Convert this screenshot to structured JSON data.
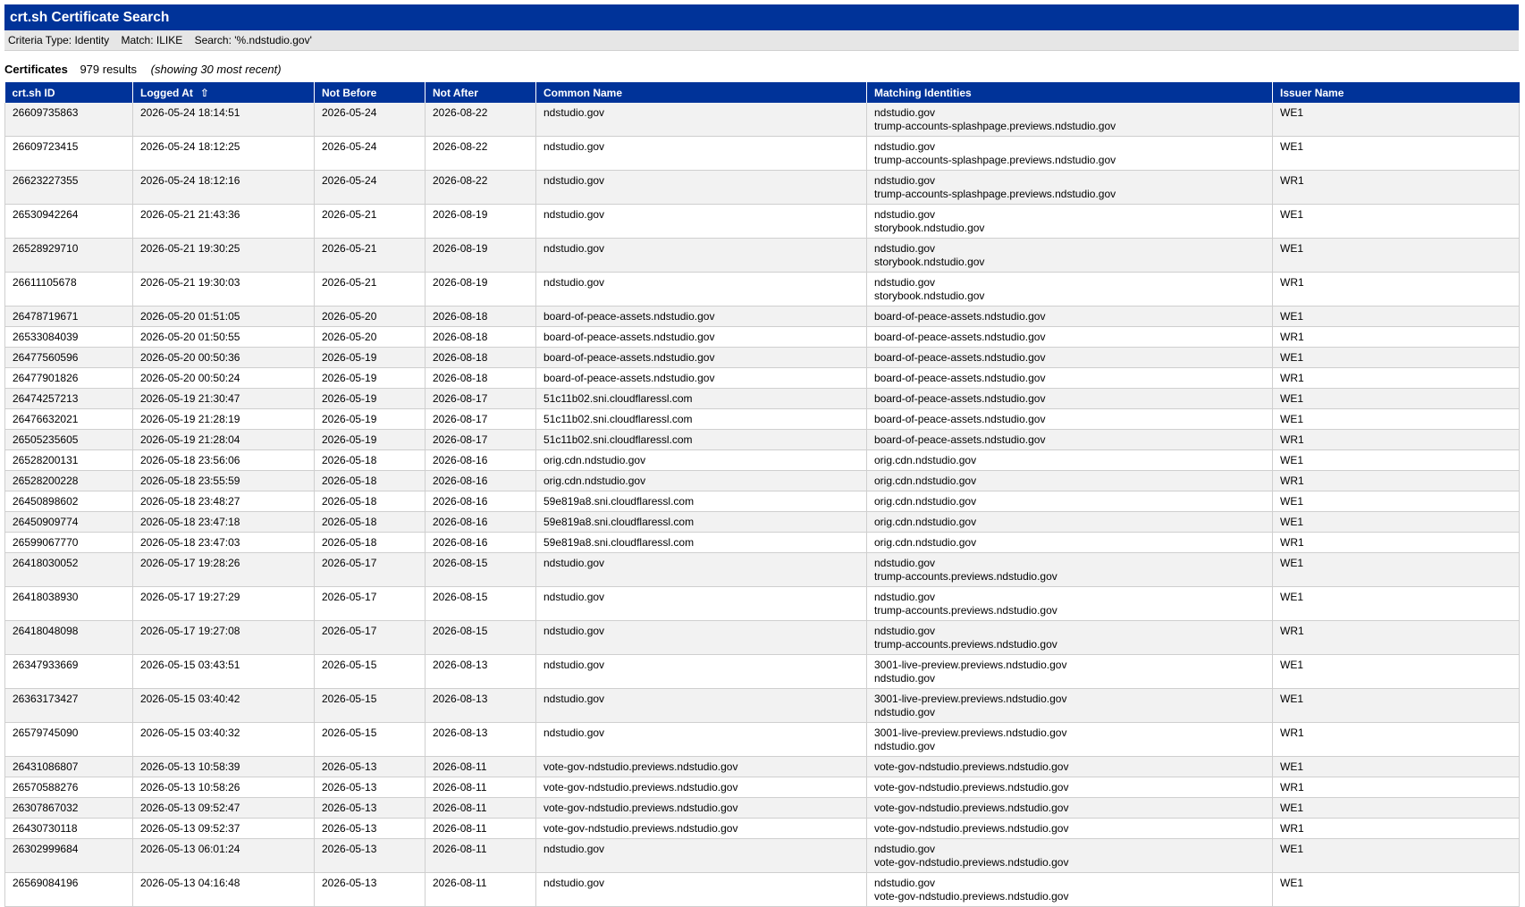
{
  "header": {
    "title": "crt.sh Certificate Search"
  },
  "criteria": {
    "type": "Criteria Type: Identity",
    "match": "Match: ILIKE",
    "search": "Search: '%.ndstudio.gov'"
  },
  "summary": {
    "label": "Certificates",
    "count": "979 results",
    "note": "(showing 30 most recent)"
  },
  "table": {
    "columns": [
      "crt.sh ID",
      "Logged At",
      "Not Before",
      "Not After",
      "Common Name",
      "Matching Identities",
      "Issuer Name"
    ],
    "sort_icon": "up-arrow-icon",
    "sort_glyph": "⇧",
    "rows": [
      {
        "id": "26609735863",
        "logged": "2026-05-24 18:14:51",
        "nb": "2026-05-24",
        "na": "2026-08-22",
        "cn": "ndstudio.gov",
        "ids": [
          "ndstudio.gov",
          "trump-accounts-splashpage.previews.ndstudio.gov"
        ],
        "issuer": "WE1"
      },
      {
        "id": "26609723415",
        "logged": "2026-05-24 18:12:25",
        "nb": "2026-05-24",
        "na": "2026-08-22",
        "cn": "ndstudio.gov",
        "ids": [
          "ndstudio.gov",
          "trump-accounts-splashpage.previews.ndstudio.gov"
        ],
        "issuer": "WE1"
      },
      {
        "id": "26623227355",
        "logged": "2026-05-24 18:12:16",
        "nb": "2026-05-24",
        "na": "2026-08-22",
        "cn": "ndstudio.gov",
        "ids": [
          "ndstudio.gov",
          "trump-accounts-splashpage.previews.ndstudio.gov"
        ],
        "issuer": "WR1"
      },
      {
        "id": "26530942264",
        "logged": "2026-05-21 21:43:36",
        "nb": "2026-05-21",
        "na": "2026-08-19",
        "cn": "ndstudio.gov",
        "ids": [
          "ndstudio.gov",
          "storybook.ndstudio.gov"
        ],
        "issuer": "WE1"
      },
      {
        "id": "26528929710",
        "logged": "2026-05-21 19:30:25",
        "nb": "2026-05-21",
        "na": "2026-08-19",
        "cn": "ndstudio.gov",
        "ids": [
          "ndstudio.gov",
          "storybook.ndstudio.gov"
        ],
        "issuer": "WE1"
      },
      {
        "id": "26611105678",
        "logged": "2026-05-21 19:30:03",
        "nb": "2026-05-21",
        "na": "2026-08-19",
        "cn": "ndstudio.gov",
        "ids": [
          "ndstudio.gov",
          "storybook.ndstudio.gov"
        ],
        "issuer": "WR1"
      },
      {
        "id": "26478719671",
        "logged": "2026-05-20 01:51:05",
        "nb": "2026-05-20",
        "na": "2026-08-18",
        "cn": "board-of-peace-assets.ndstudio.gov",
        "ids": [
          "board-of-peace-assets.ndstudio.gov"
        ],
        "issuer": "WE1"
      },
      {
        "id": "26533084039",
        "logged": "2026-05-20 01:50:55",
        "nb": "2026-05-20",
        "na": "2026-08-18",
        "cn": "board-of-peace-assets.ndstudio.gov",
        "ids": [
          "board-of-peace-assets.ndstudio.gov"
        ],
        "issuer": "WR1"
      },
      {
        "id": "26477560596",
        "logged": "2026-05-20 00:50:36",
        "nb": "2026-05-19",
        "na": "2026-08-18",
        "cn": "board-of-peace-assets.ndstudio.gov",
        "ids": [
          "board-of-peace-assets.ndstudio.gov"
        ],
        "issuer": "WE1"
      },
      {
        "id": "26477901826",
        "logged": "2026-05-20 00:50:24",
        "nb": "2026-05-19",
        "na": "2026-08-18",
        "cn": "board-of-peace-assets.ndstudio.gov",
        "ids": [
          "board-of-peace-assets.ndstudio.gov"
        ],
        "issuer": "WR1"
      },
      {
        "id": "26474257213",
        "logged": "2026-05-19 21:30:47",
        "nb": "2026-05-19",
        "na": "2026-08-17",
        "cn": "51c11b02.sni.cloudflaressl.com",
        "ids": [
          "board-of-peace-assets.ndstudio.gov"
        ],
        "issuer": "WE1"
      },
      {
        "id": "26476632021",
        "logged": "2026-05-19 21:28:19",
        "nb": "2026-05-19",
        "na": "2026-08-17",
        "cn": "51c11b02.sni.cloudflaressl.com",
        "ids": [
          "board-of-peace-assets.ndstudio.gov"
        ],
        "issuer": "WE1"
      },
      {
        "id": "26505235605",
        "logged": "2026-05-19 21:28:04",
        "nb": "2026-05-19",
        "na": "2026-08-17",
        "cn": "51c11b02.sni.cloudflaressl.com",
        "ids": [
          "board-of-peace-assets.ndstudio.gov"
        ],
        "issuer": "WR1"
      },
      {
        "id": "26528200131",
        "logged": "2026-05-18 23:56:06",
        "nb": "2026-05-18",
        "na": "2026-08-16",
        "cn": "orig.cdn.ndstudio.gov",
        "ids": [
          "orig.cdn.ndstudio.gov"
        ],
        "issuer": "WE1"
      },
      {
        "id": "26528200228",
        "logged": "2026-05-18 23:55:59",
        "nb": "2026-05-18",
        "na": "2026-08-16",
        "cn": "orig.cdn.ndstudio.gov",
        "ids": [
          "orig.cdn.ndstudio.gov"
        ],
        "issuer": "WR1"
      },
      {
        "id": "26450898602",
        "logged": "2026-05-18 23:48:27",
        "nb": "2026-05-18",
        "na": "2026-08-16",
        "cn": "59e819a8.sni.cloudflaressl.com",
        "ids": [
          "orig.cdn.ndstudio.gov"
        ],
        "issuer": "WE1"
      },
      {
        "id": "26450909774",
        "logged": "2026-05-18 23:47:18",
        "nb": "2026-05-18",
        "na": "2026-08-16",
        "cn": "59e819a8.sni.cloudflaressl.com",
        "ids": [
          "orig.cdn.ndstudio.gov"
        ],
        "issuer": "WE1"
      },
      {
        "id": "26599067770",
        "logged": "2026-05-18 23:47:03",
        "nb": "2026-05-18",
        "na": "2026-08-16",
        "cn": "59e819a8.sni.cloudflaressl.com",
        "ids": [
          "orig.cdn.ndstudio.gov"
        ],
        "issuer": "WR1"
      },
      {
        "id": "26418030052",
        "logged": "2026-05-17 19:28:26",
        "nb": "2026-05-17",
        "na": "2026-08-15",
        "cn": "ndstudio.gov",
        "ids": [
          "ndstudio.gov",
          "trump-accounts.previews.ndstudio.gov"
        ],
        "issuer": "WE1"
      },
      {
        "id": "26418038930",
        "logged": "2026-05-17 19:27:29",
        "nb": "2026-05-17",
        "na": "2026-08-15",
        "cn": "ndstudio.gov",
        "ids": [
          "ndstudio.gov",
          "trump-accounts.previews.ndstudio.gov"
        ],
        "issuer": "WE1"
      },
      {
        "id": "26418048098",
        "logged": "2026-05-17 19:27:08",
        "nb": "2026-05-17",
        "na": "2026-08-15",
        "cn": "ndstudio.gov",
        "ids": [
          "ndstudio.gov",
          "trump-accounts.previews.ndstudio.gov"
        ],
        "issuer": "WR1"
      },
      {
        "id": "26347933669",
        "logged": "2026-05-15 03:43:51",
        "nb": "2026-05-15",
        "na": "2026-08-13",
        "cn": "ndstudio.gov",
        "ids": [
          "3001-live-preview.previews.ndstudio.gov",
          "ndstudio.gov"
        ],
        "issuer": "WE1"
      },
      {
        "id": "26363173427",
        "logged": "2026-05-15 03:40:42",
        "nb": "2026-05-15",
        "na": "2026-08-13",
        "cn": "ndstudio.gov",
        "ids": [
          "3001-live-preview.previews.ndstudio.gov",
          "ndstudio.gov"
        ],
        "issuer": "WE1"
      },
      {
        "id": "26579745090",
        "logged": "2026-05-15 03:40:32",
        "nb": "2026-05-15",
        "na": "2026-08-13",
        "cn": "ndstudio.gov",
        "ids": [
          "3001-live-preview.previews.ndstudio.gov",
          "ndstudio.gov"
        ],
        "issuer": "WR1"
      },
      {
        "id": "26431086807",
        "logged": "2026-05-13 10:58:39",
        "nb": "2026-05-13",
        "na": "2026-08-11",
        "cn": "vote-gov-ndstudio.previews.ndstudio.gov",
        "ids": [
          "vote-gov-ndstudio.previews.ndstudio.gov"
        ],
        "issuer": "WE1"
      },
      {
        "id": "26570588276",
        "logged": "2026-05-13 10:58:26",
        "nb": "2026-05-13",
        "na": "2026-08-11",
        "cn": "vote-gov-ndstudio.previews.ndstudio.gov",
        "ids": [
          "vote-gov-ndstudio.previews.ndstudio.gov"
        ],
        "issuer": "WR1"
      },
      {
        "id": "26307867032",
        "logged": "2026-05-13 09:52:47",
        "nb": "2026-05-13",
        "na": "2026-08-11",
        "cn": "vote-gov-ndstudio.previews.ndstudio.gov",
        "ids": [
          "vote-gov-ndstudio.previews.ndstudio.gov"
        ],
        "issuer": "WE1"
      },
      {
        "id": "26430730118",
        "logged": "2026-05-13 09:52:37",
        "nb": "2026-05-13",
        "na": "2026-08-11",
        "cn": "vote-gov-ndstudio.previews.ndstudio.gov",
        "ids": [
          "vote-gov-ndstudio.previews.ndstudio.gov"
        ],
        "issuer": "WR1"
      },
      {
        "id": "26302999684",
        "logged": "2026-05-13 06:01:24",
        "nb": "2026-05-13",
        "na": "2026-08-11",
        "cn": "ndstudio.gov",
        "ids": [
          "ndstudio.gov",
          "vote-gov-ndstudio.previews.ndstudio.gov"
        ],
        "issuer": "WE1"
      },
      {
        "id": "26569084196",
        "logged": "2026-05-13 04:16:48",
        "nb": "2026-05-13",
        "na": "2026-08-11",
        "cn": "ndstudio.gov",
        "ids": [
          "ndstudio.gov",
          "vote-gov-ndstudio.previews.ndstudio.gov"
        ],
        "issuer": "WE1"
      }
    ]
  },
  "colors": {
    "header_bg": "#003399",
    "criteria_bg": "#e6e6e6",
    "row_alt_bg": "#f2f2f2",
    "border": "#cfcfcf"
  }
}
